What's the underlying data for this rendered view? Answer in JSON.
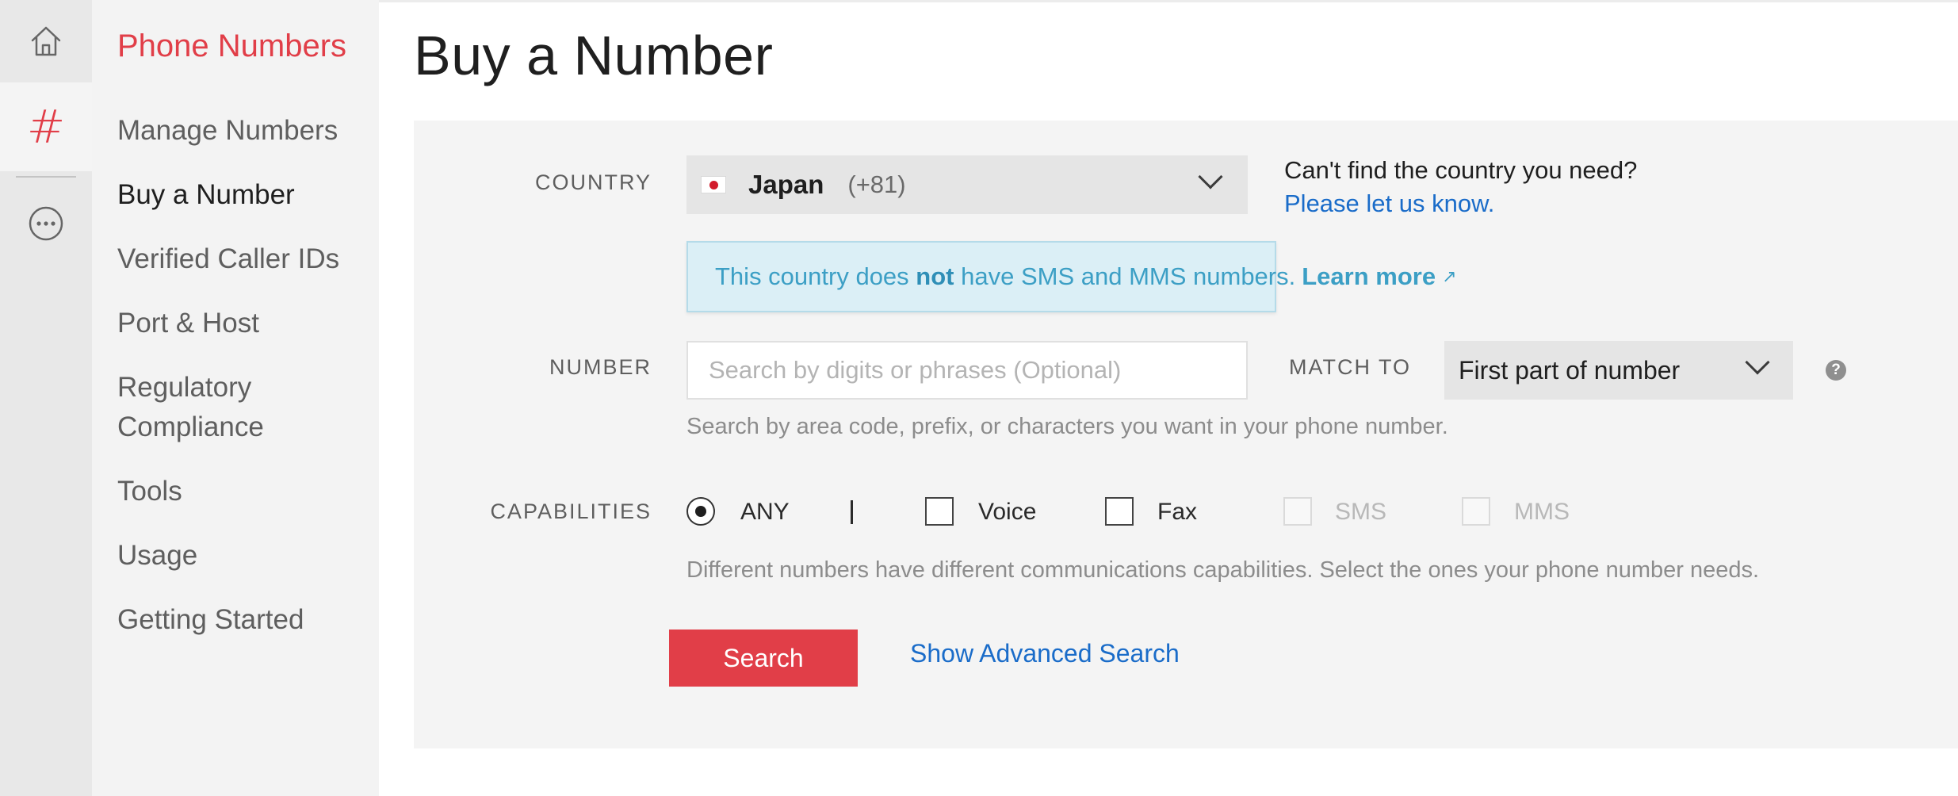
{
  "rail": {
    "icons": [
      "home-icon",
      "hash-icon",
      "more-icon"
    ],
    "hash_glyph": "#"
  },
  "sidebar": {
    "heading": "Phone Numbers",
    "items": [
      {
        "label": "Manage Numbers",
        "active": false
      },
      {
        "label": "Buy a Number",
        "active": true
      },
      {
        "label": "Verified Caller IDs",
        "active": false
      },
      {
        "label": "Port & Host",
        "active": false
      },
      {
        "label": "Regulatory Compliance",
        "active": false
      },
      {
        "label": "Tools",
        "active": false
      },
      {
        "label": "Usage",
        "active": false
      },
      {
        "label": "Getting Started",
        "active": false
      }
    ]
  },
  "page": {
    "title": "Buy a Number"
  },
  "form": {
    "country": {
      "label": "COUNTRY",
      "selected_name": "Japan",
      "selected_code": "(+81)",
      "help_question": "Can't find the country you need?",
      "help_link": "Please let us know."
    },
    "notice": {
      "prefix": "This country does ",
      "emphasis": "not",
      "suffix": " have SMS and MMS numbers.",
      "link": "Learn more",
      "link_icon": "↗"
    },
    "number": {
      "label": "NUMBER",
      "placeholder": "Search by digits or phrases (Optional)",
      "value": "",
      "hint": "Search by area code, prefix, or characters you want in your phone number."
    },
    "match_to": {
      "label": "MATCH TO",
      "selected": "First part of number",
      "help_icon": "?"
    },
    "capabilities": {
      "label": "CAPABILITIES",
      "any_label": "ANY",
      "options": [
        {
          "label": "Voice",
          "checked": false,
          "disabled": false
        },
        {
          "label": "Fax",
          "checked": false,
          "disabled": false
        },
        {
          "label": "SMS",
          "checked": false,
          "disabled": true
        },
        {
          "label": "MMS",
          "checked": false,
          "disabled": true
        }
      ],
      "hint": "Different numbers have different communications capabilities. Select the ones your phone number needs."
    },
    "search_button": "Search",
    "advanced_link": "Show Advanced Search"
  },
  "colors": {
    "brand_red": "#e13e48",
    "link_blue": "#1a6cc9",
    "notice_bg": "#dbeff6",
    "notice_text": "#3c9fc5"
  }
}
